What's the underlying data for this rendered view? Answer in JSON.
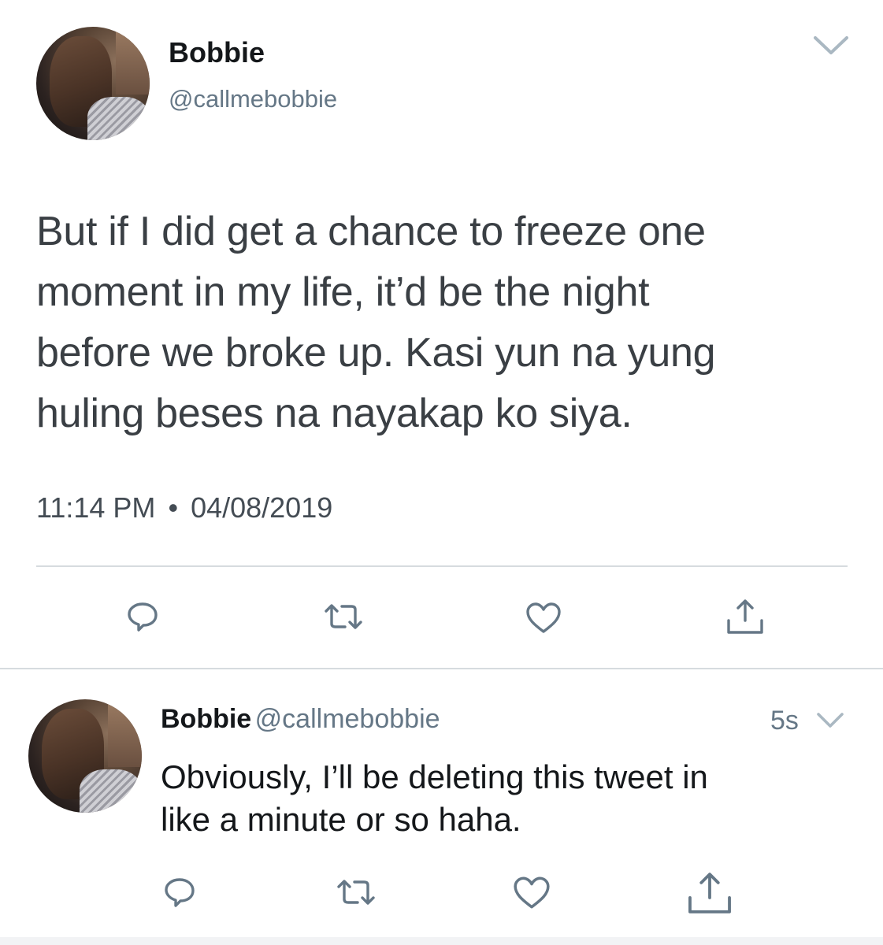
{
  "main_tweet": {
    "display_name": "Bobbie",
    "handle": "@callmebobbie",
    "text": "But if I did get a chance to freeze one moment in my life, it’d be the night before we broke up. Kasi yun na yung huling beses na nayakap ko siya.",
    "lines": [
      "But if I did get a chance to freeze one",
      "moment in my life, it’d be the night",
      "before we broke up. Kasi yun na yung",
      "huling beses na nayakap ko siya."
    ],
    "time": "11:14 PM",
    "separator": "•",
    "date": "04/08/2019",
    "actions": [
      "reply-icon",
      "retweet-icon",
      "like-icon",
      "share-icon"
    ]
  },
  "reply_tweet": {
    "display_name": "Bobbie",
    "handle": "@callmebobbie",
    "age": "5s",
    "lines": [
      "Obviously, I’ll be deleting this tweet in",
      "like a minute or so haha."
    ],
    "actions": [
      "reply-icon",
      "retweet-icon",
      "like-icon",
      "share-icon"
    ]
  },
  "colors": {
    "text_primary": "#14171a",
    "text_secondary": "#657786",
    "divider": "#d6dbdf"
  }
}
